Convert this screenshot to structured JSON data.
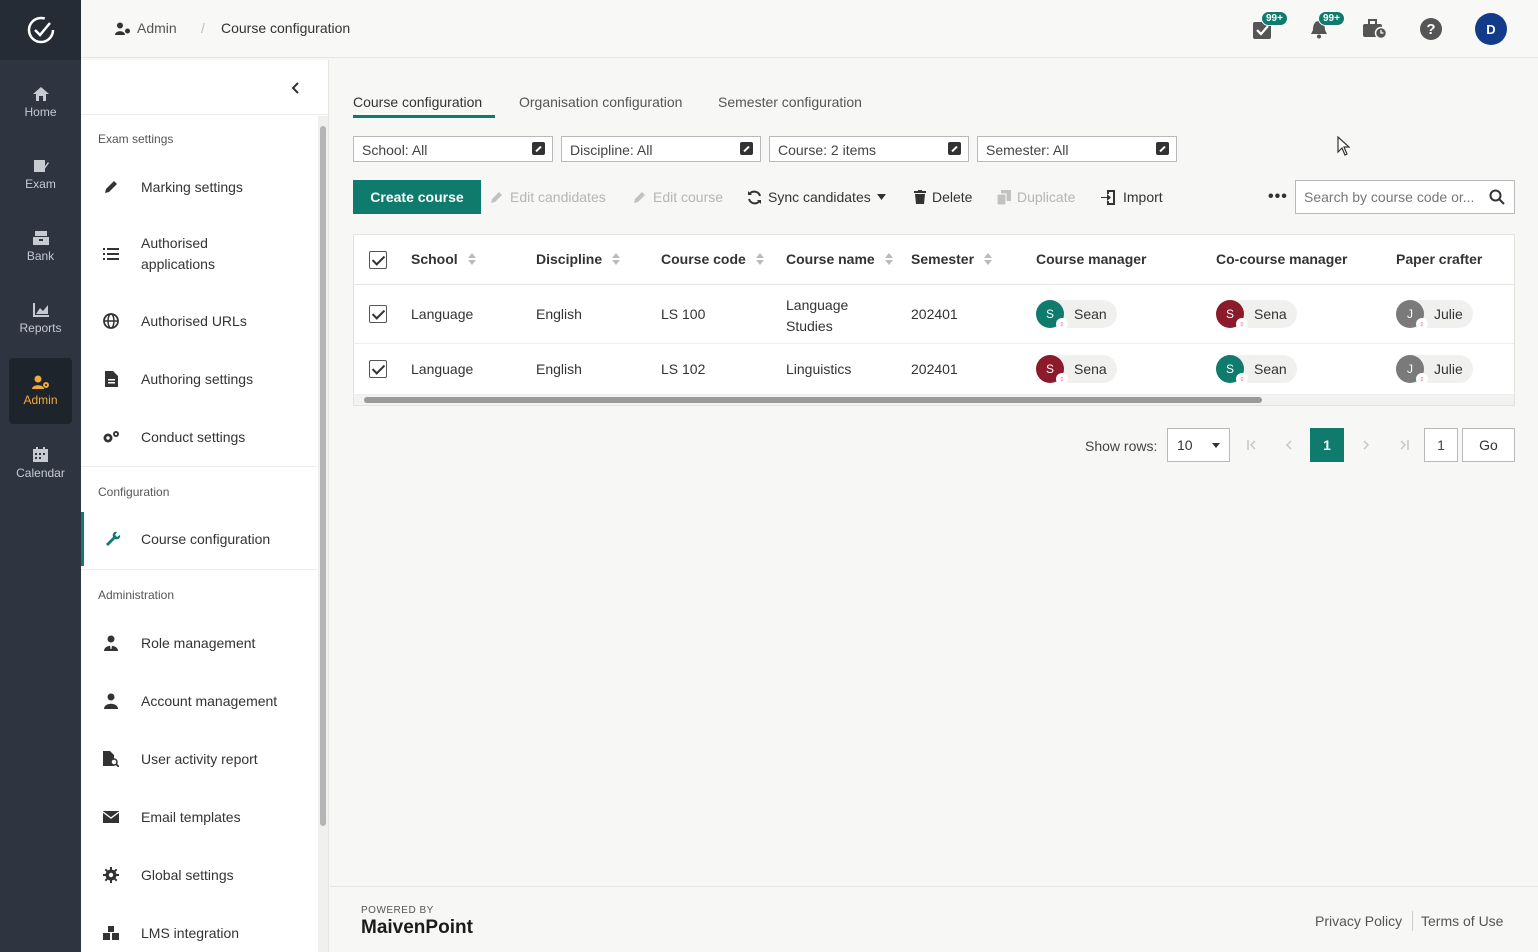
{
  "rail": {
    "items": [
      {
        "label": "Home",
        "icon": "home-icon"
      },
      {
        "label": "Exam",
        "icon": "exam-icon"
      },
      {
        "label": "Bank",
        "icon": "bank-icon"
      },
      {
        "label": "Reports",
        "icon": "reports-icon"
      },
      {
        "label": "Admin",
        "icon": "admin-icon",
        "active": true
      },
      {
        "label": "Calendar",
        "icon": "calendar-icon"
      }
    ],
    "accent": "#f2a93b"
  },
  "header": {
    "breadcrumb_admin": "Admin",
    "breadcrumb_sep": "/",
    "breadcrumb_current": "Course configuration",
    "tasks_badge": "99+",
    "notifications_badge": "99+",
    "avatar_initial": "D"
  },
  "sidenav": {
    "sections": {
      "exam_settings": "Exam settings",
      "configuration": "Configuration",
      "administration": "Administration"
    },
    "items": {
      "marking": "Marking settings",
      "authorised_apps_1": "Authorised",
      "authorised_apps_2": "applications",
      "authorised_urls": "Authorised URLs",
      "authoring": "Authoring settings",
      "conduct": "Conduct settings",
      "course_config": "Course configuration",
      "role_mgmt": "Role management",
      "account_mgmt": "Account management",
      "user_activity": "User activity report",
      "email_templates": "Email templates",
      "global_settings": "Global settings",
      "lms": "LMS integration"
    }
  },
  "tabs": {
    "course": "Course configuration",
    "organisation": "Organisation configuration",
    "semester": "Semester configuration"
  },
  "filters": {
    "school": "School: All",
    "discipline": "Discipline: All",
    "course": "Course: 2 items",
    "semester": "Semester: All"
  },
  "toolbar": {
    "create": "Create course",
    "edit_candidates": "Edit candidates",
    "edit_course": "Edit course",
    "sync_candidates": "Sync candidates",
    "delete": "Delete",
    "duplicate": "Duplicate",
    "import": "Import",
    "more": "•••",
    "search_placeholder": "Search by course code or..."
  },
  "table": {
    "columns": {
      "school": "School",
      "discipline": "Discipline",
      "course_code": "Course code",
      "course_name": "Course name",
      "semester": "Semester",
      "course_manager": "Course manager",
      "co_course_manager": "Co-course manager",
      "paper_crafter": "Paper crafter"
    },
    "rows": [
      {
        "school": "Language",
        "discipline": "English",
        "course_code": "LS 100",
        "course_name_1": "Language",
        "course_name_2": "Studies",
        "semester": "202401",
        "course_manager": {
          "name": "Sean",
          "initial": "S",
          "color": "#0f7b6c"
        },
        "co_course_manager": {
          "name": "Sena",
          "initial": "S",
          "color": "#8b1a2b"
        },
        "paper_crafter": {
          "name": "Julie",
          "initial": "J",
          "color": "#7a7a7a"
        }
      },
      {
        "school": "Language",
        "discipline": "English",
        "course_code": "LS 102",
        "course_name_1": "Linguistics",
        "course_name_2": "",
        "semester": "202401",
        "course_manager": {
          "name": "Sena",
          "initial": "S",
          "color": "#8b1a2b"
        },
        "co_course_manager": {
          "name": "Sean",
          "initial": "S",
          "color": "#0f7b6c"
        },
        "paper_crafter": {
          "name": "Julie",
          "initial": "J",
          "color": "#7a7a7a"
        }
      }
    ]
  },
  "pagination": {
    "show_rows_label": "Show rows:",
    "rows_value": "10",
    "first": "K",
    "prev": "‹",
    "next": "›",
    "last": "›|",
    "current_page": "1",
    "page_input": "1",
    "go": "Go"
  },
  "footer": {
    "powered_by": "POWERED BY",
    "brand": "MaivenPoint",
    "privacy": "Privacy Policy",
    "terms": "Terms of Use"
  },
  "colors": {
    "primary": "#0f7b6c",
    "rail_bg": "#2e3540"
  }
}
